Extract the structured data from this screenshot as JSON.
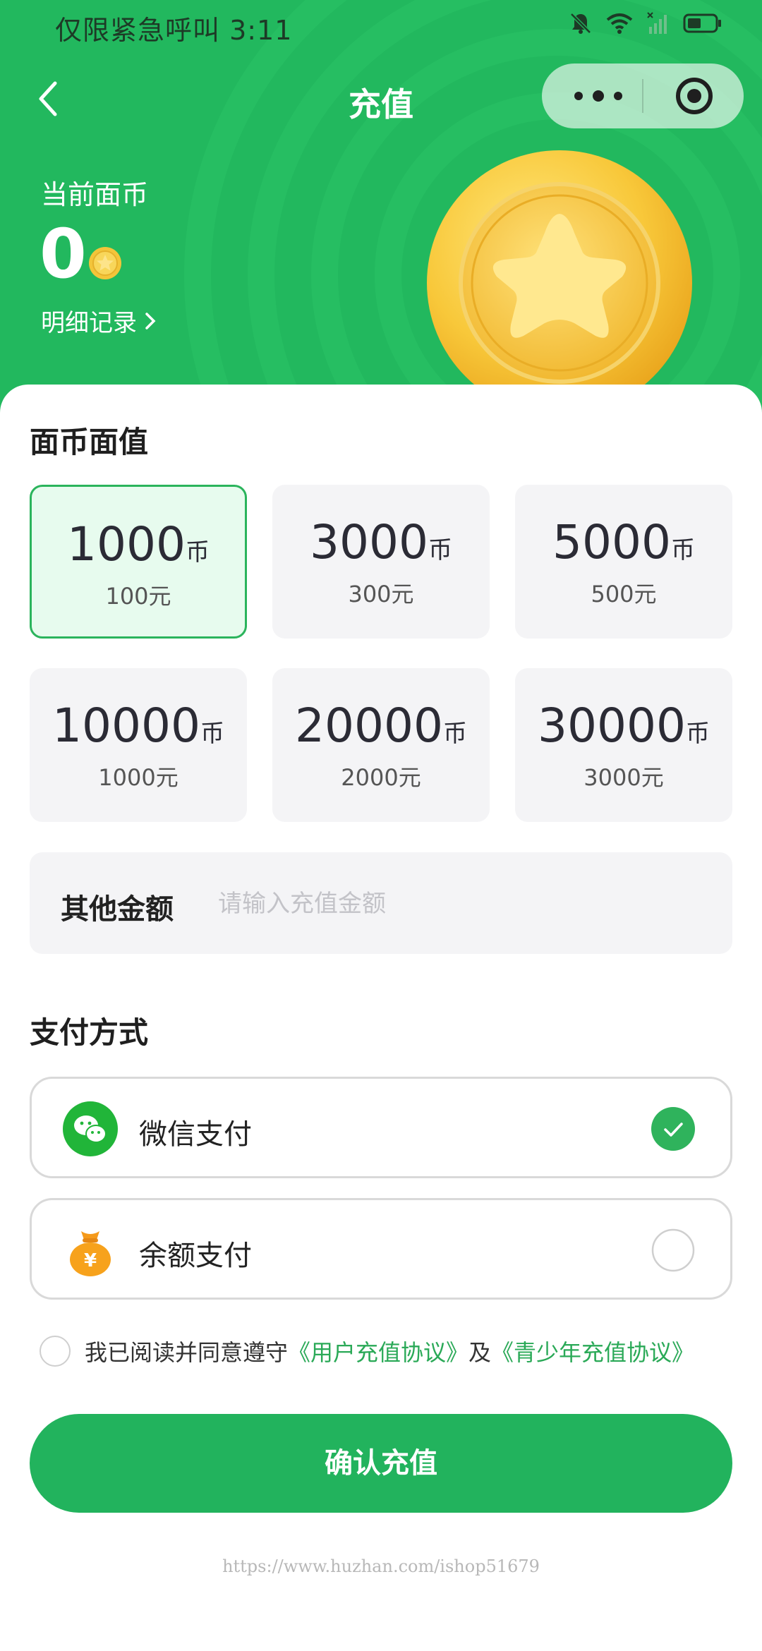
{
  "status_bar": {
    "text": "仅限紧急呼叫 3:11"
  },
  "nav": {
    "title": "充值"
  },
  "balance": {
    "label": "当前面币",
    "value": "0",
    "detail_link": "明细记录"
  },
  "denomination": {
    "title": "面币面值",
    "unit": "币",
    "options": [
      {
        "coins": "1000",
        "price": "100元",
        "selected": true
      },
      {
        "coins": "3000",
        "price": "300元",
        "selected": false
      },
      {
        "coins": "5000",
        "price": "500元",
        "selected": false
      },
      {
        "coins": "10000",
        "price": "1000元",
        "selected": false
      },
      {
        "coins": "20000",
        "price": "2000元",
        "selected": false
      },
      {
        "coins": "30000",
        "price": "3000元",
        "selected": false
      }
    ],
    "other_label": "其他金额",
    "other_placeholder": "请输入充值金额"
  },
  "payment": {
    "title": "支付方式",
    "methods": [
      {
        "label": "微信支付",
        "icon": "wechat-pay-icon",
        "selected": true
      },
      {
        "label": "余额支付",
        "icon": "money-bag-icon",
        "selected": false
      }
    ]
  },
  "agreement": {
    "prefix": "我已阅读并同意遵守",
    "link1": "《用户充值协议》",
    "and": "及",
    "link2": "《青少年充值协议》"
  },
  "confirm_button": "确认充值",
  "watermark": "https://www.huzhan.com/ishop51679",
  "colors": {
    "brand_green": "#22b85e",
    "selected_border": "#2bb45c",
    "link": "#2aa957"
  }
}
